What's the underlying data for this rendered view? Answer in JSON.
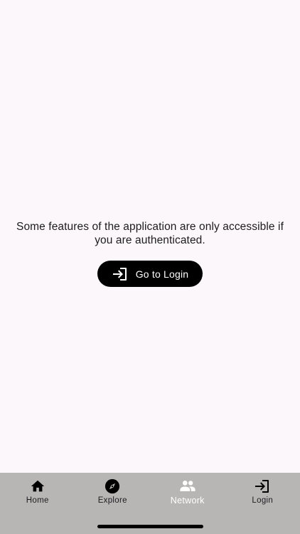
{
  "auth_prompt": {
    "message": "Some features of the application are only accessible if you are authenticated.",
    "button_label": "Go to Login",
    "button_icon": "login-icon"
  },
  "tabbar": {
    "background_color": "#b8b6b5",
    "tabs": [
      {
        "label": "Home",
        "icon": "home-icon"
      },
      {
        "label": "Explore",
        "icon": "compass-icon"
      },
      {
        "label": "Network",
        "icon": "people-icon"
      },
      {
        "label": "Login",
        "icon": "login-icon"
      }
    ]
  }
}
